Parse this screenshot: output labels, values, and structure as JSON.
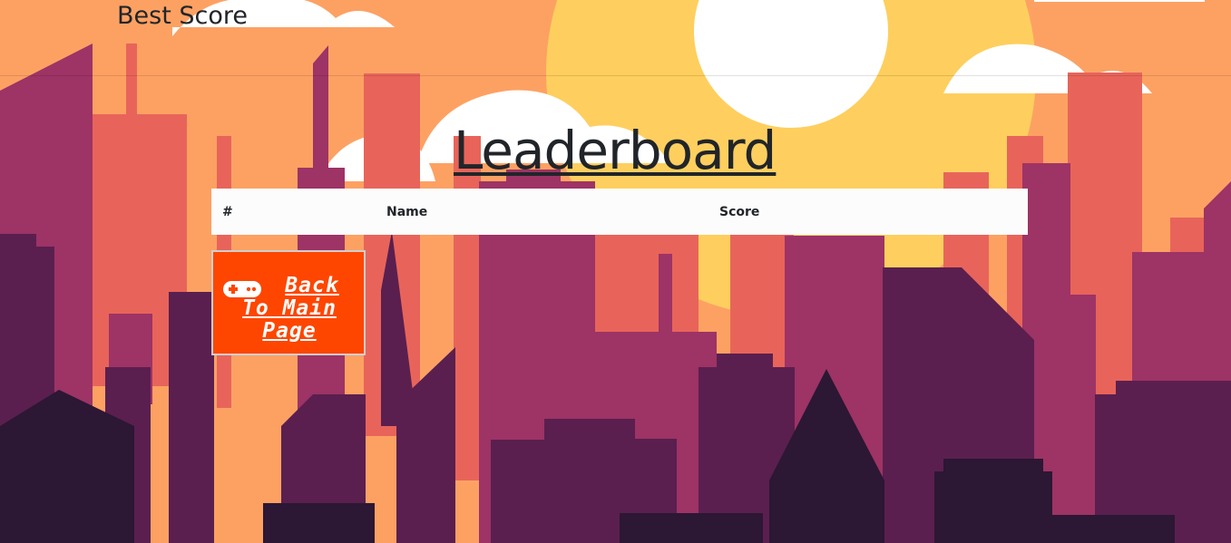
{
  "header": {
    "best_score_label": "Best Score"
  },
  "page": {
    "title": "Leaderboard"
  },
  "leaderboard": {
    "columns": [
      "#",
      "Name",
      "Score"
    ],
    "rows": []
  },
  "back_button": {
    "label": "Back To Main Page",
    "icon": "gamepad-icon"
  },
  "colors": {
    "sky": "#fda163",
    "sun": "#fecf5e",
    "building_far": "#e8645a",
    "building_mid": "#9e3365",
    "building_near": "#5a1f4f",
    "building_front": "#2c1734",
    "button": "#fe4600"
  }
}
